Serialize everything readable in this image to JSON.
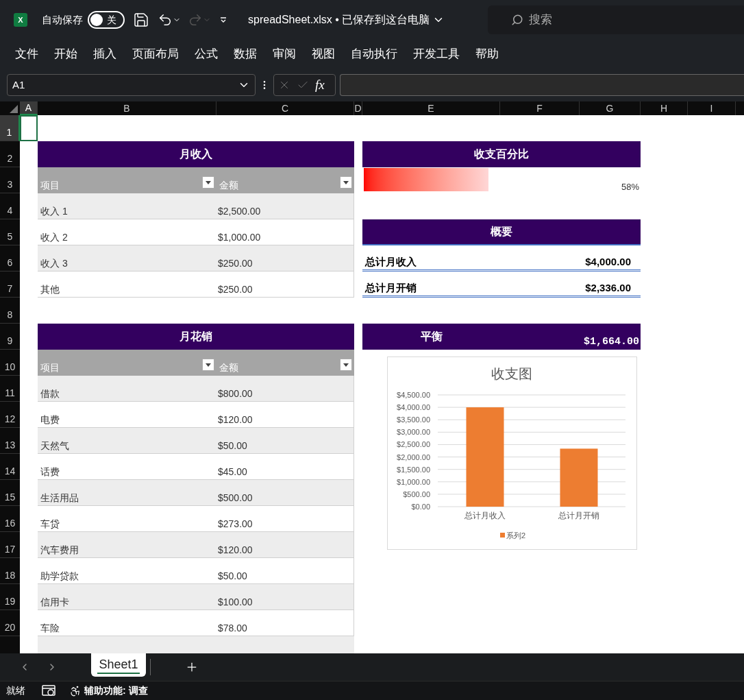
{
  "title_bar": {
    "logo_letter": "X",
    "autosave_label": "自动保存",
    "autosave": {
      "on": false,
      "label": "关"
    },
    "undo": {
      "disabled": false
    },
    "redo": {
      "disabled": true
    },
    "file_title": "spreadSheet.xlsx • 已保存到这台电脑",
    "search": {
      "placeholder": "搜索"
    }
  },
  "menu": [
    "文件",
    "开始",
    "插入",
    "页面布局",
    "公式",
    "数据",
    "审阅",
    "视图",
    "自动执行",
    "开发工具",
    "帮助"
  ],
  "formula_bar": {
    "name_box": "A1",
    "fx": "fx"
  },
  "columns": [
    {
      "label": "A",
      "selected": true
    },
    {
      "label": "B",
      "selected": false
    },
    {
      "label": "C",
      "selected": false
    },
    {
      "label": "D",
      "selected": false
    },
    {
      "label": "E",
      "selected": false
    },
    {
      "label": "F",
      "selected": false
    },
    {
      "label": "G",
      "selected": false
    },
    {
      "label": "H",
      "selected": false
    },
    {
      "label": "I",
      "selected": false
    }
  ],
  "rows": [
    {
      "label": "1",
      "selected": true
    },
    {
      "label": "2",
      "selected": false
    },
    {
      "label": "3",
      "selected": false
    },
    {
      "label": "4",
      "selected": false
    },
    {
      "label": "5",
      "selected": false
    },
    {
      "label": "6",
      "selected": false
    },
    {
      "label": "7",
      "selected": false
    },
    {
      "label": "8",
      "selected": false
    },
    {
      "label": "9",
      "selected": false
    },
    {
      "label": "10",
      "selected": false
    },
    {
      "label": "11",
      "selected": false
    },
    {
      "label": "12",
      "selected": false
    },
    {
      "label": "13",
      "selected": false
    },
    {
      "label": "14",
      "selected": false
    },
    {
      "label": "15",
      "selected": false
    },
    {
      "label": "16",
      "selected": false
    },
    {
      "label": "17",
      "selected": false
    },
    {
      "label": "18",
      "selected": false
    },
    {
      "label": "19",
      "selected": false
    },
    {
      "label": "20",
      "selected": false
    }
  ],
  "income_table": {
    "title": "月收入",
    "headers": [
      "项目",
      "金额"
    ],
    "rows": [
      {
        "item": "收入 1",
        "amount": "$2,500.00"
      },
      {
        "item": "收入 2",
        "amount": "$1,000.00"
      },
      {
        "item": "收入 3",
        "amount": "$250.00"
      },
      {
        "item": "其他",
        "amount": "$250.00"
      }
    ]
  },
  "expense_table": {
    "title": "月花销",
    "headers": [
      "项目",
      "金额"
    ],
    "rows": [
      {
        "item": "借款",
        "amount": "$800.00"
      },
      {
        "item": "电费",
        "amount": "$120.00"
      },
      {
        "item": "天然气",
        "amount": "$50.00"
      },
      {
        "item": "话费",
        "amount": "$45.00"
      },
      {
        "item": "生活用品",
        "amount": "$500.00"
      },
      {
        "item": "车贷",
        "amount": "$273.00"
      },
      {
        "item": "汽车费用",
        "amount": "$120.00"
      },
      {
        "item": "助学贷款",
        "amount": "$50.00"
      },
      {
        "item": "信用卡",
        "amount": "$100.00"
      },
      {
        "item": "车险",
        "amount": "$78.00"
      }
    ]
  },
  "percent": {
    "title": "收支百分比",
    "level": 0.45,
    "reading": "58%"
  },
  "summary": {
    "title": "概要",
    "rows": [
      {
        "label": "总计月收入",
        "value": "$4,000.00"
      },
      {
        "label": "总计月开销",
        "value": "$2,336.00"
      }
    ]
  },
  "balance": {
    "label": "平衡",
    "value": "$1,664.00"
  },
  "chart": {
    "chart_data": {
      "type": "bar",
      "title": "收支图",
      "categories": [
        "总计月收入",
        "总计月开销"
      ],
      "series": [
        {
          "name": "系列2",
          "color": "#ed7d31",
          "values": [
            4000,
            2336
          ]
        }
      ],
      "ylim": [
        0,
        4500
      ],
      "grid": true,
      "yticks": [
        {
          "value": 0,
          "label": "$0.00"
        },
        {
          "value": 500,
          "label": "$500.00"
        },
        {
          "value": 1000,
          "label": "$1,000.00"
        },
        {
          "value": 1500,
          "label": "$1,500.00"
        },
        {
          "value": 2000,
          "label": "$2,000.00"
        },
        {
          "value": 2500,
          "label": "$2,500.00"
        },
        {
          "value": 3000,
          "label": "$3,000.00"
        },
        {
          "value": 3500,
          "label": "$3,500.00"
        },
        {
          "value": 4000,
          "label": "$4,000.00"
        },
        {
          "value": 4500,
          "label": "$4,500.00"
        }
      ]
    }
  },
  "sheet_tabs": [
    {
      "label": "Sheet1",
      "selected": true
    }
  ],
  "status_bar": {
    "ready": "就绪",
    "accessibility": "辅助功能: 调查"
  }
}
